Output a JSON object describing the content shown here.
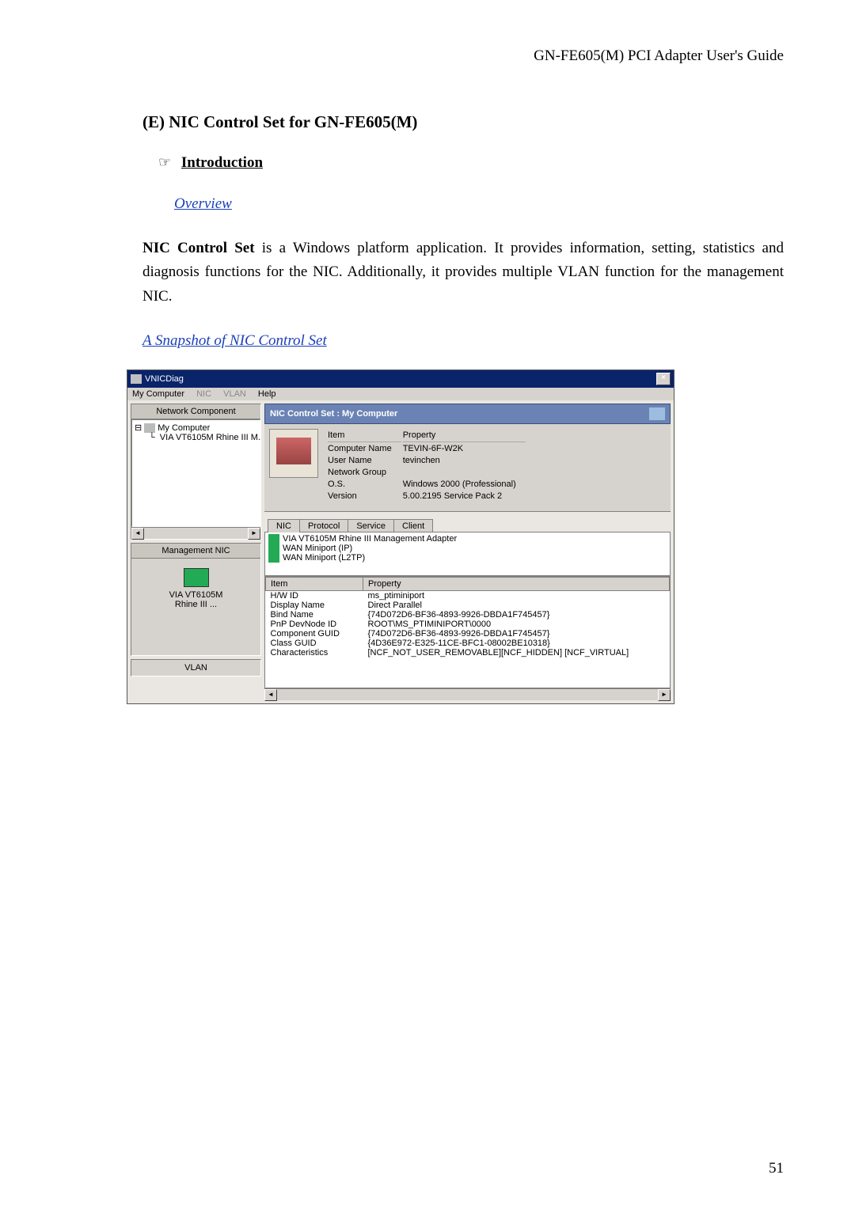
{
  "header": "GN-FE605(M)  PCI  Adapter  User's  Guide",
  "section_title": "(E) NIC Control Set for GN-FE605(M)",
  "intro_label": "Introduction",
  "overview_label": "Overview",
  "body": "NIC Control Set is a Windows platform application. It provides information, setting, statistics and diagnosis functions for the NIC. Additionally, it provides multiple VLAN function for the management NIC.",
  "snapshot_label": "A Snapshot of NIC Control Set",
  "page_number": "51",
  "app": {
    "title": "VNICDiag",
    "menu": {
      "item1": "My Computer",
      "item2": "NIC",
      "item3": "VLAN",
      "item4": "Help"
    },
    "left": {
      "panel1_head": "Network Component",
      "tree_root": "My Computer",
      "tree_child": "VIA VT6105M Rhine III M.",
      "panel2_head": "Management NIC",
      "mgmt_line1": "VIA VT6105M",
      "mgmt_line2": "Rhine III ...",
      "panel3_head": "VLAN"
    },
    "right": {
      "headline": "NIC Control Set : My Computer",
      "sys": {
        "col1": "Item",
        "col2": "Property",
        "r1a": "Computer Name",
        "r1b": "TEVIN-6F-W2K",
        "r2a": "User Name",
        "r2b": "tevinchen",
        "r3a": "Network Group",
        "r3b": "",
        "r4a": "O.S.",
        "r4b": "Windows 2000 (Professional)",
        "r5a": "Version",
        "r5b": "5.00.2195 Service Pack 2"
      },
      "tabs": {
        "t1": "NIC",
        "t2": "Protocol",
        "t3": "Service",
        "t4": "Client"
      },
      "niclist": {
        "l1": "VIA VT6105M Rhine III Management Adapter",
        "l2": "WAN Miniport (IP)",
        "l3": "WAN Miniport (L2TP)"
      },
      "props": {
        "h1": "Item",
        "h2": "Property",
        "r1a": "H/W ID",
        "r1b": "ms_ptiminiport",
        "r2a": "Display Name",
        "r2b": "Direct Parallel",
        "r3a": "Bind Name",
        "r3b": "{74D072D6-BF36-4893-9926-DBDA1F745457}",
        "r4a": "PnP DevNode ID",
        "r4b": "ROOT\\MS_PTIMINIPORT\\0000",
        "r5a": "Component GUID",
        "r5b": "{74D072D6-BF36-4893-9926-DBDA1F745457}",
        "r6a": "Class GUID",
        "r6b": "{4D36E972-E325-11CE-BFC1-08002BE10318}",
        "r7a": "Characteristics",
        "r7b": "[NCF_NOT_USER_REMOVABLE][NCF_HIDDEN] [NCF_VIRTUAL]"
      }
    }
  }
}
